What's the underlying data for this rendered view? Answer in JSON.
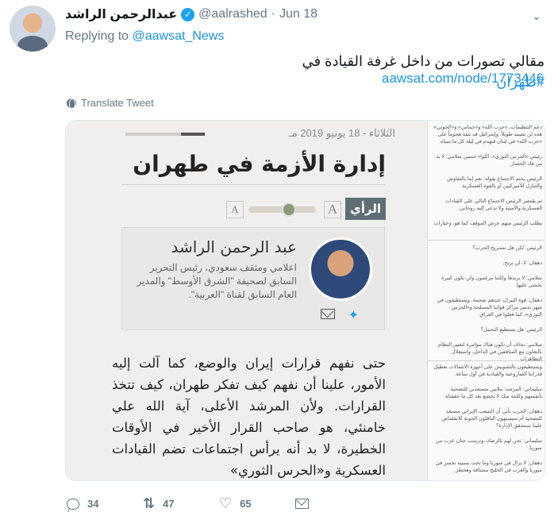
{
  "tweet": {
    "author_name": "عبدالرحمن الراشد",
    "verified": true,
    "handle": "@aalrashed",
    "date": "Jun 18",
    "replying_label": "Replying to",
    "replying_to": "@aawsat_News",
    "text_prefix": "مقالي تصورات من داخل غرفة القيادة في",
    "hashtag": "#طهران",
    "link": "aawsat.com/node/1773446",
    "translate_label": "Translate Tweet"
  },
  "article": {
    "date": "الثلاثاء - 18 يونيو 2019 مـ",
    "title": "إدارة الأزمة في طهران",
    "opinion_tag": "الرأي",
    "font_small": "A",
    "font_large": "A",
    "font_size_level": 0.6,
    "author_name": "عبد الرحمن الراشد",
    "author_bio": "اعلامي ومثقف سعودي، رئيس التحرير السابق لصحيفة \"الشرق الأوسط\" والمدير العام السابق لقناة \"العربية\".",
    "body": "حتى نفهم قرارات إيران والوضع، كما آلت إليه الأمور، علينا أن نفهم كيف تفكر طهران، كيف تتخذ القرارات. ولأن المرشد الأعلى، آية الله علي خامنئي، هو صاحب القرار الأخير في الأوقات الخطيرة، لا بد أنه يرأس اجتماعات تضم القيادات العسكرية و«الحرس الثوري»"
  },
  "side_paragraphs": [
    "دعم التنظيمات، «حزب الله» و«حماس» و«الحوثي» هذه لن تصمد طويلاً. وإسرائيل قد تنفذ هجوماً على «حزب الله» في لبنان فتهدم في ليلة كل ما بنيناه.",
    "رئيس «الحرس الثوري»، اللواء حسين سلامي: لا بد من فك الحصار.",
    "الرئيس يختم الاجتماع بقوله: نعم إما بالتفاوض والتنازل للأميركيين أو بالقوة العسكرية.",
    "ثم يقتصر الرئيس الاجتماع التالي على القيادات العسكرية والأمنية ولا يدعى إليه روحاني.",
    "يطلب الرئيس منهم عرض الموقف كما هو، وخيارات",
    "الرئيس: لكن هل نستريح الحرب؟",
    "دهقان: لا، لن نربح.",
    "سلامي: لا نريدها ولكننا مرغمون ولن تكون كبيرة نخشى عليها.",
    "دهقان: قوة النيران عندهم ضخمة، ويستطيعون في شهر تدمير مراكز قواتنا المسلحة و«الحرس الثوري»، كما فعلوا في العراق.",
    "الرئيس: هل نستطيع التحمل؟",
    "سلامي: نخاف أن تكون هناك مؤامرة لتغيير النظام بالتعاون مع المنافقين في الداخل، واستغلال التظاهرات",
    "ويستطيعون بالتشويش على أجهزة الاتصالات تعطيل قدراتنا الصاروخية والقيادية في أول ساعة.",
    "سليماني: المرشد: ملايين مستعدين للتضحية بأنفسهم وكلمة منك لا تخضع بعد كل ما حققناه.",
    "دهقان: الحرب تأتي أن الشعب الإيراني مستعد للتضحية أم سيستهون الناقلون الخونة للانقضاض علينا سنتحقق الإدارة؟",
    "سليماني: نحن لهم بالرصاد، وترسب جنان عرب من سوريا.",
    "دهقان: لا يزال في سوريا وما تحت بسببه تخسر في سوريا والعرب في الخليج مشتاقة وهخطر."
  ],
  "actions": {
    "reply_count": "34",
    "retweet_count": "47",
    "like_count": "65"
  }
}
